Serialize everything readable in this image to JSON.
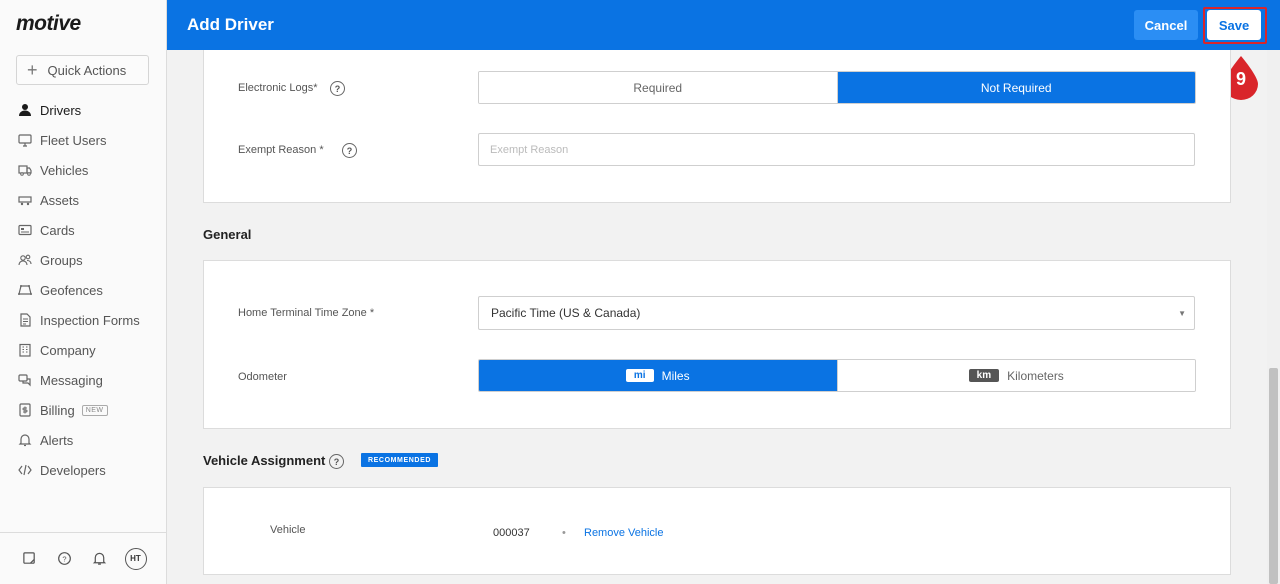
{
  "app": {
    "logo": "motive"
  },
  "sidebar": {
    "quick_actions": "Quick Actions",
    "items": [
      {
        "label": "Drivers",
        "icon": "person-icon",
        "active": true
      },
      {
        "label": "Fleet Users",
        "icon": "monitor-icon"
      },
      {
        "label": "Vehicles",
        "icon": "truck-icon"
      },
      {
        "label": "Assets",
        "icon": "trailer-icon"
      },
      {
        "label": "Cards",
        "icon": "card-icon"
      },
      {
        "label": "Groups",
        "icon": "groups-icon"
      },
      {
        "label": "Geofences",
        "icon": "geofence-icon"
      },
      {
        "label": "Inspection Forms",
        "icon": "document-icon"
      },
      {
        "label": "Company",
        "icon": "building-icon"
      },
      {
        "label": "Messaging",
        "icon": "chat-icon"
      },
      {
        "label": "Billing",
        "icon": "billing-icon",
        "badge": "NEW"
      },
      {
        "label": "Alerts",
        "icon": "bell-icon"
      },
      {
        "label": "Developers",
        "icon": "code-icon"
      }
    ],
    "bottom": {
      "avatar": "HT"
    }
  },
  "header": {
    "title": "Add Driver",
    "cancel_label": "Cancel",
    "save_label": "Save",
    "step_number": "9",
    "highlight_color": "#d9252a"
  },
  "compliance": {
    "electronic_logs_label": "Electronic Logs*",
    "electronic_logs_options": [
      "Required",
      "Not Required"
    ],
    "electronic_logs_selected": "Not Required",
    "exempt_reason_label": "Exempt Reason *",
    "exempt_reason_placeholder": "Exempt Reason"
  },
  "general": {
    "title": "General",
    "time_zone_label": "Home Terminal Time Zone *",
    "time_zone_value": "Pacific Time (US & Canada)",
    "odometer_label": "Odometer",
    "odometer_options": [
      {
        "chip": "mi",
        "label": "Miles"
      },
      {
        "chip": "km",
        "label": "Kilometers"
      }
    ],
    "odometer_selected": "Miles"
  },
  "vehicle_assignment": {
    "title": "Vehicle Assignment",
    "badge": "RECOMMENDED",
    "vehicle_label": "Vehicle",
    "vehicle_id": "000037",
    "separator": "•",
    "remove_label": "Remove Vehicle"
  },
  "colors": {
    "brand": "#0a73e3",
    "accent_red": "#d9252a"
  }
}
